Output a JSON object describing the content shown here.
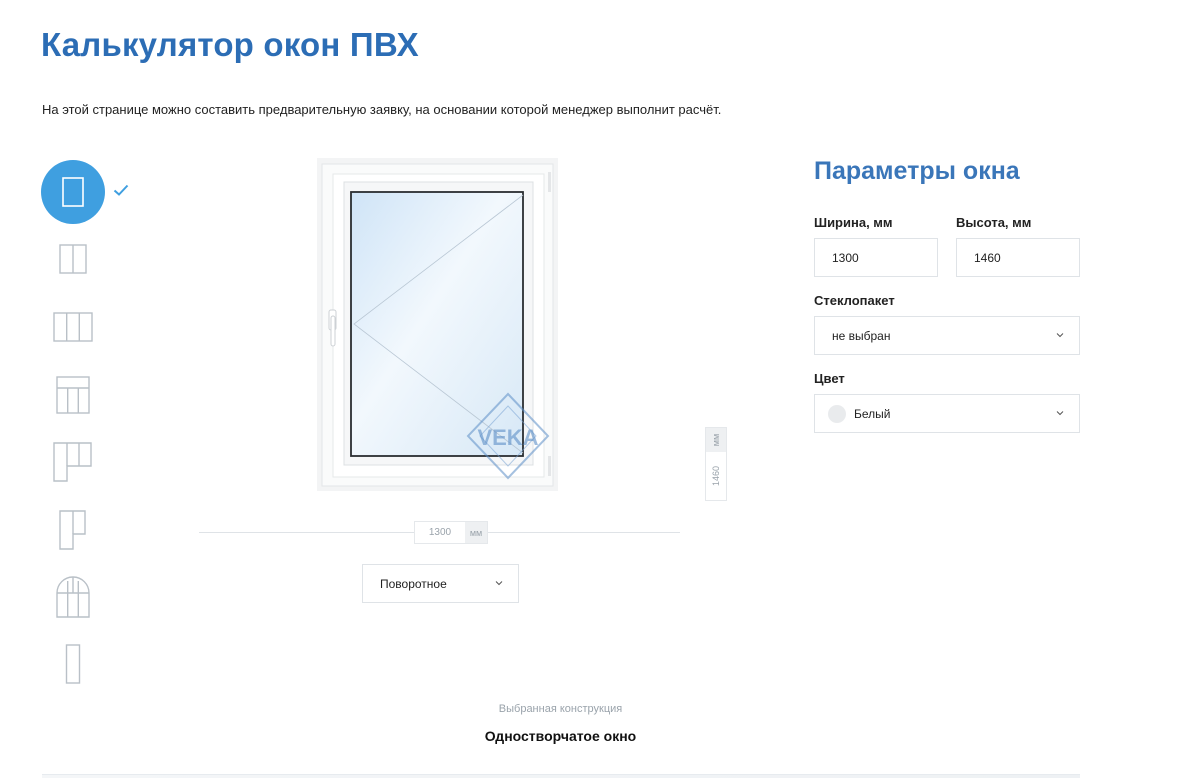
{
  "header": {
    "title": "Калькулятор окон ПВХ",
    "intro": "На этой странице можно составить предварительную заявку, на основании которой менеджер выполнит расчёт."
  },
  "window_types": {
    "items": [
      {
        "icon": "single-sash-window-icon",
        "selected": true
      },
      {
        "icon": "double-sash-window-icon",
        "selected": false
      },
      {
        "icon": "triple-sash-window-icon",
        "selected": false
      },
      {
        "icon": "transom-window-icon",
        "selected": false
      },
      {
        "icon": "balcony-block-left-icon",
        "selected": false
      },
      {
        "icon": "balcony-door-icon",
        "selected": false
      },
      {
        "icon": "arched-window-icon",
        "selected": false
      },
      {
        "icon": "narrow-window-icon",
        "selected": false
      }
    ],
    "selected_mark_icon": "checkmark-icon"
  },
  "preview": {
    "logo_text": "VEKA",
    "height_value": "1460",
    "height_unit": "мм",
    "width_value": "1300",
    "width_unit": "мм",
    "opening_type": "Поворотное"
  },
  "construction": {
    "caption": "Выбранная конструкция",
    "name": "Одностворчатое окно"
  },
  "params": {
    "title": "Параметры окна",
    "width_label": "Ширина, мм",
    "width_value": "1300",
    "height_label": "Высота, мм",
    "height_value": "1460",
    "glass_label": "Стеклопакет",
    "glass_value": "не выбран",
    "color_label": "Цвет",
    "color_value": "Белый",
    "color_swatch": "#e9ebed"
  },
  "colors": {
    "accent": "#2c6db5",
    "active_circle": "#3f9fe0"
  }
}
